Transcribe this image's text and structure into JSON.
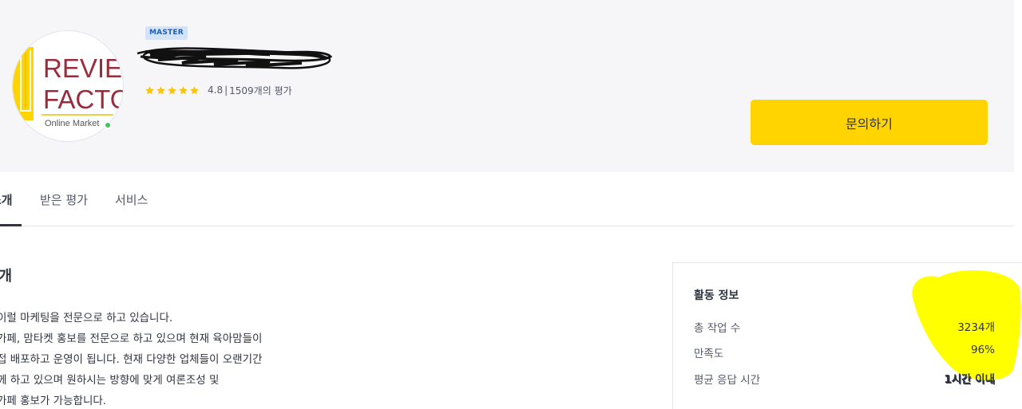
{
  "profile": {
    "grade_badge": "MASTER",
    "logo": {
      "line1": "REVIE",
      "line2": "FACTO",
      "line3": "Online Market"
    },
    "rating": {
      "score": "4.8",
      "separator": "|",
      "review_count": "1509개의 평가",
      "stars": 5
    },
    "online": true,
    "inquiry_button": "문의하기"
  },
  "tabs": [
    {
      "label": "소개",
      "active": true
    },
    {
      "label": "받은 평가",
      "active": false
    },
    {
      "label": "서비스",
      "active": false
    }
  ],
  "intro": {
    "title": "소개",
    "lines": [
      "이럴 마케팅을 전문으로 하고 있습니다.",
      "가페, 맘타켓 홍보를 전문으로 하고 있으며 현재 육아맘들이",
      "접 배포하고 운영이 됩니다. 현재 다양한 업체들이 오랜기간",
      "께 하고 있으며 원하시는 방향에 맞게 여론조성 및",
      "가페 홍보가 가능합니다."
    ]
  },
  "activity": {
    "title": "활동 정보",
    "stats": [
      {
        "label": "총 작업 수",
        "value": "3234개"
      },
      {
        "label": "만족도",
        "value": "96%"
      },
      {
        "label": "평균 응답 시간",
        "value": "1시간 이내"
      }
    ]
  },
  "colors": {
    "accent": "#ffd400",
    "star": "#ffc400",
    "highlight": "#ffff00",
    "logo_text": "#9b2c3c",
    "online": "#3cc85a"
  }
}
